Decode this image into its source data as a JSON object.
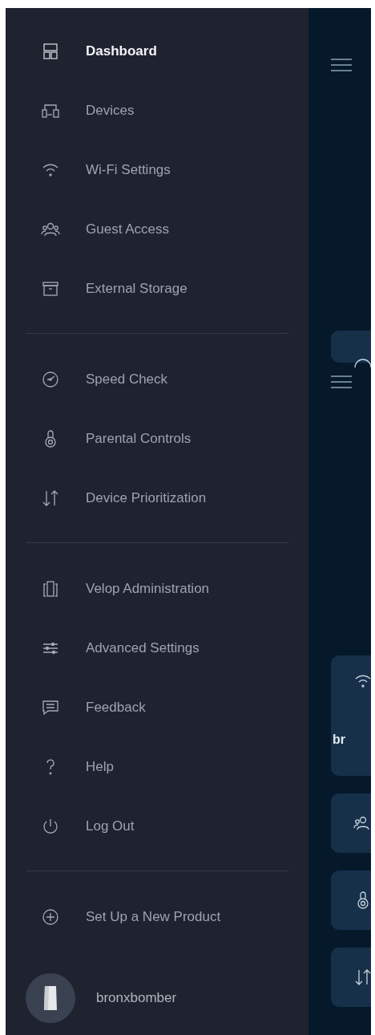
{
  "drawer": {
    "sections": [
      {
        "items": [
          {
            "label": "Dashboard",
            "selected": true
          },
          {
            "label": "Devices",
            "selected": false
          },
          {
            "label": "Wi-Fi Settings",
            "selected": false
          },
          {
            "label": "Guest Access",
            "selected": false
          },
          {
            "label": "External Storage",
            "selected": false
          }
        ]
      },
      {
        "items": [
          {
            "label": "Speed Check",
            "selected": false
          },
          {
            "label": "Parental Controls",
            "selected": false
          },
          {
            "label": "Device Prioritization",
            "selected": false
          }
        ]
      },
      {
        "items": [
          {
            "label": "Velop Administration",
            "selected": false
          },
          {
            "label": "Advanced Settings",
            "selected": false
          },
          {
            "label": "Feedback",
            "selected": false
          },
          {
            "label": "Help",
            "selected": false
          },
          {
            "label": "Log Out",
            "selected": false
          }
        ]
      },
      {
        "items": [
          {
            "label": "Set Up a New Product",
            "selected": false
          }
        ]
      }
    ],
    "profile": {
      "name": "bronxbomber"
    }
  },
  "background_screen": {
    "cards": [
      {
        "kind": "gauge"
      },
      {
        "kind": "wifi",
        "text": "br"
      },
      {
        "kind": "guest"
      },
      {
        "kind": "lock"
      },
      {
        "kind": "arrows"
      }
    ]
  }
}
